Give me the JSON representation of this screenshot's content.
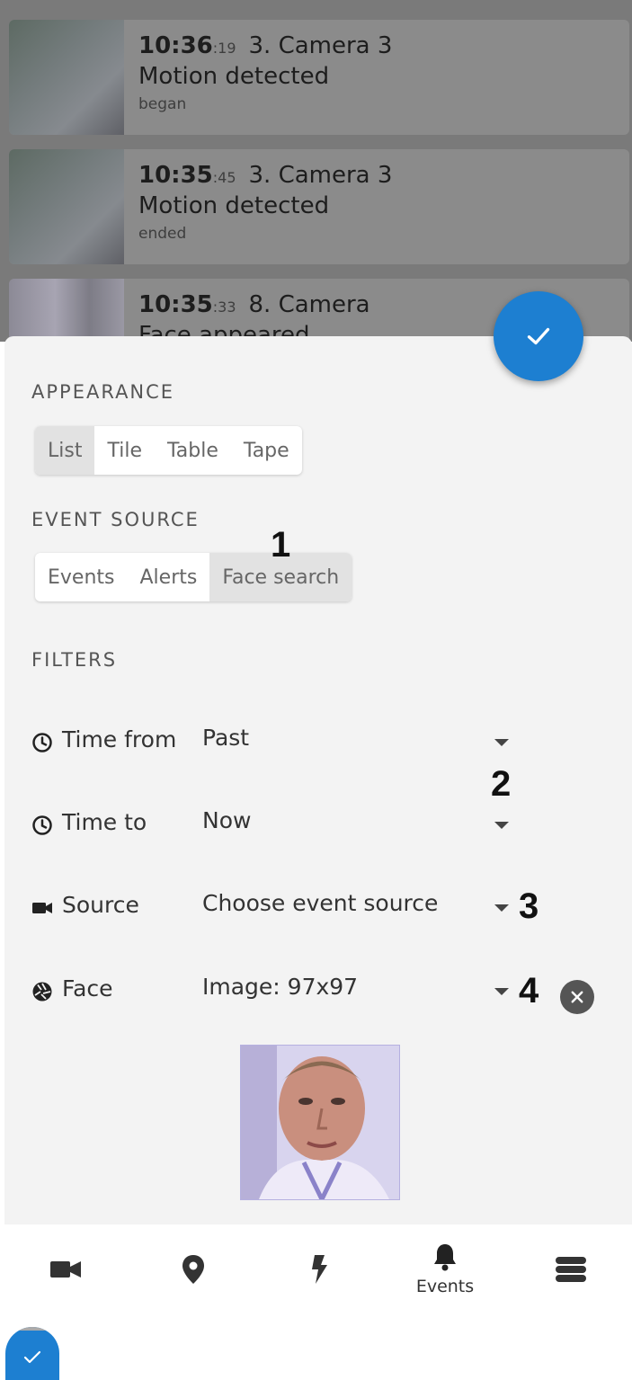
{
  "events": [
    {
      "time_main": "10:36",
      "time_sec": ":19",
      "camera": "3. Camera 3",
      "title": "Motion detected",
      "status": "began"
    },
    {
      "time_main": "10:35",
      "time_sec": ":45",
      "camera": "3. Camera 3",
      "title": "Motion detected",
      "status": "ended"
    },
    {
      "time_main": "10:35",
      "time_sec": ":33",
      "camera": "8. Camera",
      "title": "Face appeared",
      "status": ""
    }
  ],
  "sheet": {
    "appearance_label": "APPEARANCE",
    "appearance_options": [
      "List",
      "Tile",
      "Table",
      "Tape"
    ],
    "appearance_selected": "List",
    "event_source_label": "EVENT SOURCE",
    "event_source_options": [
      "Events",
      "Alerts",
      "Face search"
    ],
    "event_source_selected": "Face search",
    "filters_label": "FILTERS",
    "filters": [
      {
        "label": "Time from",
        "value": "Past",
        "icon": "clock-icon"
      },
      {
        "label": "Time to",
        "value": "Now",
        "icon": "clock-icon"
      },
      {
        "label": "Source",
        "value": "Choose event source",
        "icon": "video-camera-icon"
      },
      {
        "label": "Face",
        "value": "Image: 97x97",
        "icon": "aperture-icon"
      }
    ]
  },
  "annotations": [
    "1",
    "2",
    "3",
    "4"
  ],
  "bottom_nav": [
    {
      "icon": "video-camera-icon",
      "label": ""
    },
    {
      "icon": "map-pin-icon",
      "label": ""
    },
    {
      "icon": "lightning-icon",
      "label": ""
    },
    {
      "icon": "bell-icon",
      "label": "Events"
    },
    {
      "icon": "server-icon",
      "label": ""
    }
  ],
  "colors": {
    "accent": "#1d7fd1",
    "sheet_bg": "#f3f3f3",
    "selected_segment": "#e2e2e2"
  }
}
